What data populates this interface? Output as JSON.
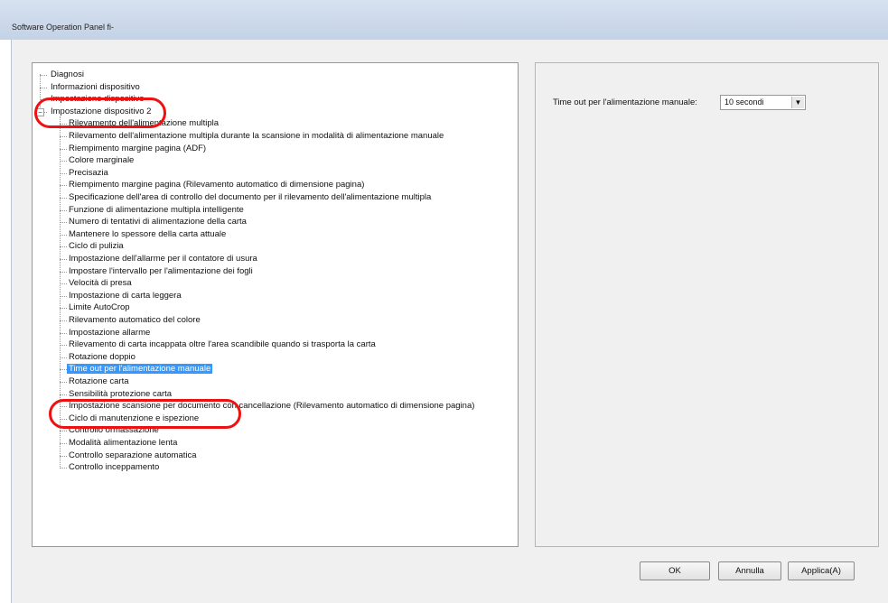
{
  "window": {
    "title": "Software Operation Panel fi-"
  },
  "tree": {
    "nodes": [
      {
        "label": "Diagnosi",
        "level": 0
      },
      {
        "label": "Informazioni dispositivo",
        "level": 0
      },
      {
        "label": "Impostazione dispositivo",
        "level": 0
      },
      {
        "label": "Impostazione dispositivo 2",
        "level": 0,
        "expander": "−"
      },
      {
        "label": "Rilevamento dell'alimentazione multipla",
        "level": 1
      },
      {
        "label": "Rilevamento dell'alimentazione multipla durante la scansione in modalità di alimentazione manuale",
        "level": 1
      },
      {
        "label": "Riempimento margine pagina (ADF)",
        "level": 1
      },
      {
        "label": "Colore marginale",
        "level": 1
      },
      {
        "label": "Precisazia",
        "level": 1
      },
      {
        "label": "Riempimento margine pagina (Rilevamento automatico di dimensione pagina)",
        "level": 1
      },
      {
        "label": "Specificazione dell'area di controllo del documento per il rilevamento dell'alimentazione multipla",
        "level": 1
      },
      {
        "label": "Funzione di alimentazione multipla intelligente",
        "level": 1
      },
      {
        "label": "Numero di tentativi di alimentazione della carta",
        "level": 1
      },
      {
        "label": "Mantenere lo spessore della carta attuale",
        "level": 1
      },
      {
        "label": "Ciclo di pulizia",
        "level": 1
      },
      {
        "label": "Impostazione dell'allarme per il contatore di usura",
        "level": 1
      },
      {
        "label": "Impostare l'intervallo per l'alimentazione dei fogli",
        "level": 1
      },
      {
        "label": "Velocità di presa",
        "level": 1
      },
      {
        "label": "Impostazione di carta leggera",
        "level": 1
      },
      {
        "label": "Limite AutoCrop",
        "level": 1
      },
      {
        "label": "Rilevamento automatico del colore",
        "level": 1
      },
      {
        "label": "Impostazione allarme",
        "level": 1
      },
      {
        "label": "Rilevamento di carta incappata oltre l'area scandibile quando si trasporta la carta",
        "level": 1
      },
      {
        "label": "Rotazione doppio",
        "level": 1
      },
      {
        "label": "Time out per l'alimentazione manuale",
        "level": 1,
        "selected": true
      },
      {
        "label": "Rotazione carta",
        "level": 1
      },
      {
        "label": "Sensibilità protezione carta",
        "level": 1
      },
      {
        "label": "Impostazione scansione per documento con cancellazione (Rilevamento automatico di dimensione pagina)",
        "level": 1
      },
      {
        "label": "Ciclo di manutenzione e ispezione",
        "level": 1
      },
      {
        "label": "Controllo ormassazione",
        "level": 1
      },
      {
        "label": "Modalità alimentazione lenta",
        "level": 1
      },
      {
        "label": "Controllo separazione automatica",
        "level": 1
      },
      {
        "label": "Controllo inceppamento",
        "level": 1
      }
    ]
  },
  "panel": {
    "setting_label": "Time out per l'alimentazione manuale:",
    "setting_value": "10 secondi",
    "dropdown_icon": "chevron-down-icon"
  },
  "buttons": {
    "ok": "OK",
    "cancel": "Annulla",
    "apply": "Applica(A)"
  },
  "colors": {
    "selection": "#3399ff",
    "highlight_oval": "#e11111"
  }
}
